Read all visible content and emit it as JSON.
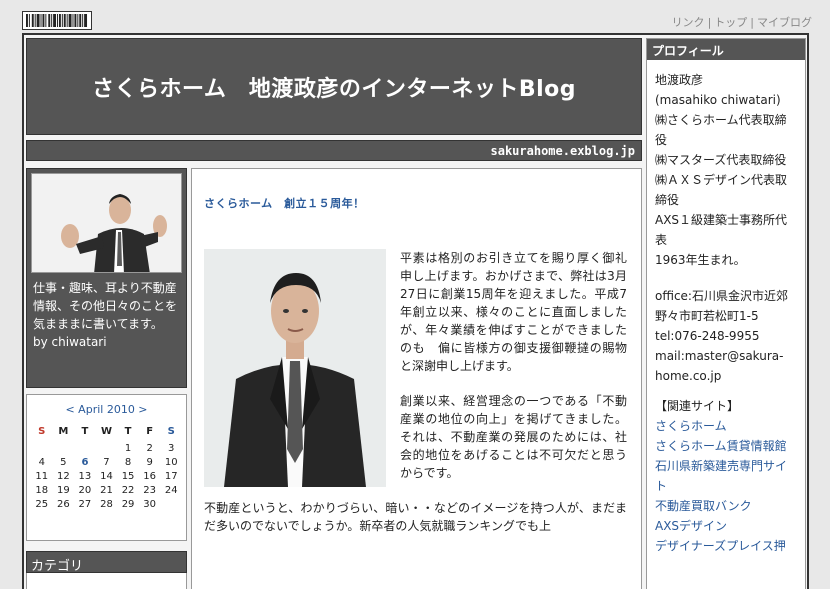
{
  "toplinks": {
    "link": "リンク",
    "top": "トップ",
    "myblog": "マイブログ",
    "sep": "|"
  },
  "header": {
    "title": "さくらホーム　地渡政彦のインターネットBlog",
    "domain": "sakurahome.exblog.jp"
  },
  "profile_box": {
    "desc": "仕事・趣味、耳より不動産情報、その他日々のことを気まままに書いてます。",
    "by": "by chiwatari"
  },
  "calendar": {
    "title": "< April 2010 >",
    "dow": [
      "S",
      "M",
      "T",
      "W",
      "T",
      "F",
      "S"
    ],
    "rows": [
      [
        "",
        "",
        "",
        "",
        "1",
        "2",
        "3"
      ],
      [
        "4",
        "5",
        "6",
        "7",
        "8",
        "9",
        "10"
      ],
      [
        "11",
        "12",
        "13",
        "14",
        "15",
        "16",
        "17"
      ],
      [
        "18",
        "19",
        "20",
        "21",
        "22",
        "23",
        "24"
      ],
      [
        "25",
        "26",
        "27",
        "28",
        "29",
        "30",
        ""
      ]
    ],
    "highlight": "6"
  },
  "category": {
    "title": "カテゴリ"
  },
  "post": {
    "title": "さくらホーム　創立１５周年！",
    "paragraphs": [
      "平素は格別のお引き立てを賜り厚く御礼申し上げます。おかげさまで、弊社は3月27日に創業15周年を迎えました。平成7年創立以来、様々のことに直面しましたが、年々業績を伸ばすことができましたのも　偏に皆様方の御支援御鞭撻の賜物と深謝申し上げます。",
      "創業以来、経営理念の一つである「不動産業の地位の向上」を掲げてきました。それは、不動産業の発展のためには、社会的地位をあげることは不可欠だと思うからです。",
      "不動産というと、わかりづらい、暗い・・などのイメージを持つ人が、まだまだ多いのでないでしょうか。新卒者の人気就職ランキングでも上"
    ]
  },
  "right": {
    "head": "プロフィール",
    "lines": [
      "地渡政彦",
      "(masahiko chiwatari)",
      "㈱さくらホーム代表取締役",
      "㈱マスターズ代表取締役",
      "㈱ＡＸＳデザイン代表取締役",
      "AXS１級建築士事務所代表",
      "1963年生まれ。"
    ],
    "contact": [
      "office:石川県金沢市近郊野々市町若松町1-5",
      "tel:076-248-9955",
      "mail:master@sakura-home.co.jp"
    ],
    "related_head": "【関連サイト】",
    "related": [
      "さくらホーム",
      "さくらホーム賃貸情報館",
      "石川県新築建売専門サイト",
      "不動産買取バンク",
      "AXSデザイン",
      "デザイナーズプレイス押"
    ]
  }
}
